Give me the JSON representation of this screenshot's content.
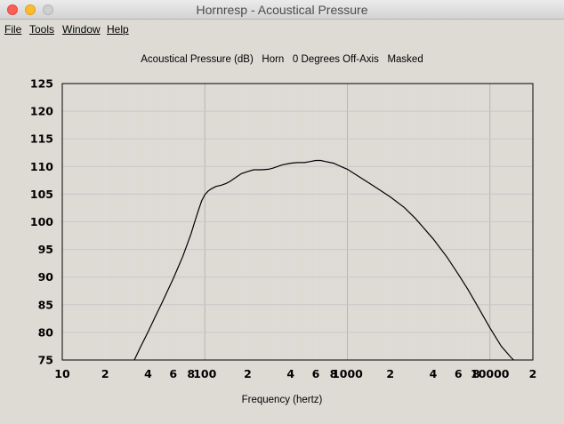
{
  "window": {
    "title": "Hornresp - Acoustical Pressure"
  },
  "menu": {
    "items": [
      "File",
      "Tools",
      "Window",
      "Help"
    ]
  },
  "chart_header": {
    "quantity": "Acoustical Pressure (dB)",
    "source": "Horn",
    "angle": "0 Degrees Off-Axis",
    "mode": "Masked"
  },
  "chart_data": {
    "type": "line",
    "title": "",
    "xlabel": "Frequency (hertz)",
    "ylabel": "",
    "xscale": "log",
    "xlim": [
      10,
      20000
    ],
    "ylim": [
      75,
      125
    ],
    "grid": true,
    "y_ticks": [
      75,
      80,
      85,
      90,
      95,
      100,
      105,
      110,
      115,
      120,
      125
    ],
    "x_ticks": [
      {
        "value": 10,
        "label": "10"
      },
      {
        "value": 20,
        "label": "2"
      },
      {
        "value": 40,
        "label": "4"
      },
      {
        "value": 60,
        "label": "6"
      },
      {
        "value": 80,
        "label": "8"
      },
      {
        "value": 100,
        "label": "100"
      },
      {
        "value": 200,
        "label": "2"
      },
      {
        "value": 400,
        "label": "4"
      },
      {
        "value": 600,
        "label": "6"
      },
      {
        "value": 800,
        "label": "8"
      },
      {
        "value": 1000,
        "label": "1000"
      },
      {
        "value": 2000,
        "label": "2"
      },
      {
        "value": 4000,
        "label": "4"
      },
      {
        "value": 6000,
        "label": "6"
      },
      {
        "value": 8000,
        "label": "8"
      },
      {
        "value": 10000,
        "label": "10000"
      },
      {
        "value": 20000,
        "label": "2"
      }
    ],
    "series": [
      {
        "x": [
          32,
          35,
          40,
          45,
          50,
          55,
          60,
          65,
          70,
          75,
          80,
          85,
          90,
          95,
          100,
          105,
          110,
          120,
          130,
          140,
          150,
          160,
          180,
          200,
          220,
          250,
          280,
          300,
          350,
          400,
          450,
          500,
          550,
          600,
          650,
          700,
          800,
          900,
          1000,
          1200,
          1500,
          2000,
          2500,
          3000,
          4000,
          5000,
          6000,
          7000,
          8000,
          10000,
          12000,
          14000,
          15500
        ],
        "y": [
          75.0,
          77.1,
          80.1,
          82.9,
          85.3,
          87.6,
          89.7,
          91.8,
          93.7,
          95.8,
          97.8,
          100.0,
          102.0,
          103.8,
          104.9,
          105.5,
          105.9,
          106.4,
          106.6,
          106.9,
          107.3,
          107.8,
          108.7,
          109.1,
          109.4,
          109.4,
          109.5,
          109.7,
          110.3,
          110.6,
          110.7,
          110.7,
          110.9,
          111.1,
          111.1,
          110.9,
          110.6,
          110.0,
          109.5,
          108.2,
          106.6,
          104.5,
          102.6,
          100.6,
          96.9,
          93.6,
          90.5,
          87.8,
          85.2,
          80.8,
          77.5,
          75.5,
          74.4
        ]
      }
    ]
  }
}
